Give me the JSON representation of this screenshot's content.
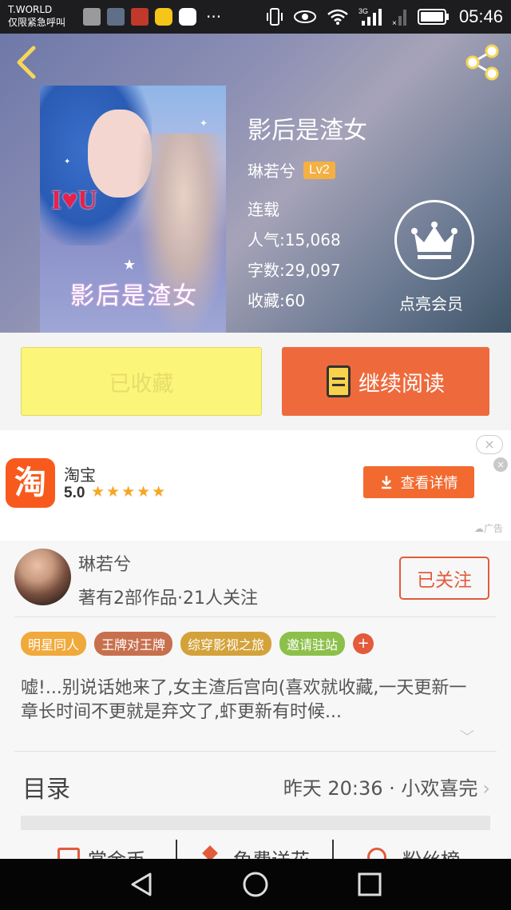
{
  "status_bar": {
    "carrier": "T.WORLD",
    "emergency": "仅限紧急呼叫",
    "network": "3G",
    "time": "05:46"
  },
  "book": {
    "cover_text": "I♥U",
    "cover_title": "影后是渣女",
    "title": "影后是渣女",
    "author": "琳若兮",
    "level": "Lv2",
    "status": "连载",
    "popularity_label": "人气:",
    "popularity": "15,068",
    "word_count_label": "字数:",
    "word_count": "29,097",
    "favorites_label": "收藏:",
    "favorites": "60",
    "vip_label": "点亮会员"
  },
  "actions": {
    "favorite_label": "已收藏",
    "read_label": "继续阅读"
  },
  "ad": {
    "app_name": "淘宝",
    "logo_char": "淘",
    "rating": "5.0",
    "stars": "★★★★★",
    "button_label": "查看详情",
    "ad_tag": "广告",
    "close_icon": "×"
  },
  "author_section": {
    "name": "琳若兮",
    "stats": "著有2部作品·21人关注",
    "follow_label": "已关注"
  },
  "tags": [
    {
      "label": "明星同人",
      "color": "#f0a93b"
    },
    {
      "label": "王牌对王牌",
      "color": "#c8704e"
    },
    {
      "label": "综穿影视之旅",
      "color": "#d4a23a"
    },
    {
      "label": "邀请驻站",
      "color": "#8cc04a"
    }
  ],
  "tag_plus": "+",
  "description": "嘘!...别说话她来了,女主渣后宫向(喜欢就收藏,一天更新一章长时间不更就是弃文了,虾更新有时候...",
  "toc": {
    "title": "目录",
    "latest": "昨天 20:36 · 小欢喜完",
    "arrow": "›"
  },
  "bottom_actions": [
    "赏金币",
    "免费送花",
    "粉丝榜"
  ],
  "colors": {
    "accent": "#ee6a3c",
    "favorite_bg": "#fbf57a",
    "follow": "#e25b3b"
  }
}
